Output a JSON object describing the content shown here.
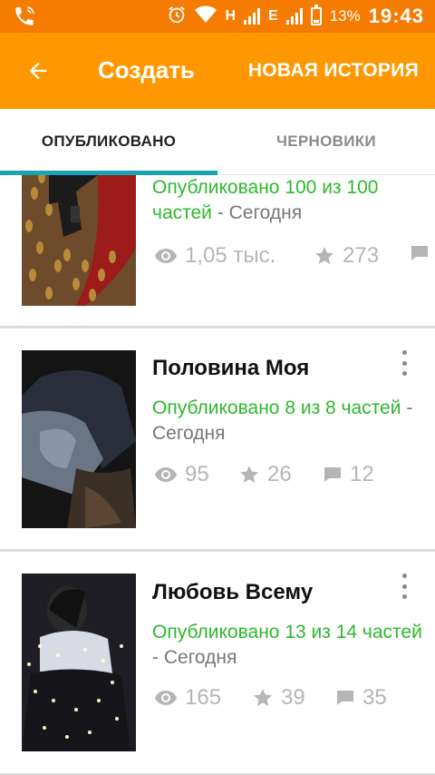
{
  "status_bar": {
    "network_h": "H",
    "network_e": "E",
    "battery_percent": "13%",
    "time": "19:43",
    "icons": [
      "phone-icon",
      "alarm-icon",
      "wifi-icon",
      "signal-icon",
      "battery-icon"
    ]
  },
  "app_bar": {
    "back_icon": "arrow-left-icon",
    "title": "Создать",
    "action_label": "НОВАЯ ИСТОРИЯ"
  },
  "tabs": [
    {
      "label": "ОПУБЛИКОВАНО",
      "selected": true
    },
    {
      "label": "ЧЕРНОВИКИ",
      "selected": false
    }
  ],
  "stories": [
    {
      "title": "",
      "status": "Опубликовано 100 из 100 частей",
      "separator": "-",
      "date": "Сегодня",
      "views": "1,05 тыс.",
      "votes": "273",
      "comments": ""
    },
    {
      "title": "Половина Моя",
      "status": "Опубликовано 8 из 8 частей",
      "separator": "-",
      "date": "Сегодня",
      "views": "95",
      "votes": "26",
      "comments": "12"
    },
    {
      "title": "Любовь Всему",
      "status": "Опубликовано 13 из 14 частей",
      "separator": "-",
      "date": "Сегодня",
      "views": "165",
      "votes": "39",
      "comments": "35"
    }
  ],
  "colors": {
    "status_bar": "#f57c00",
    "app_bar": "#ff9800",
    "tab_indicator": "#1aa3b5",
    "published_text": "#2db92d"
  }
}
